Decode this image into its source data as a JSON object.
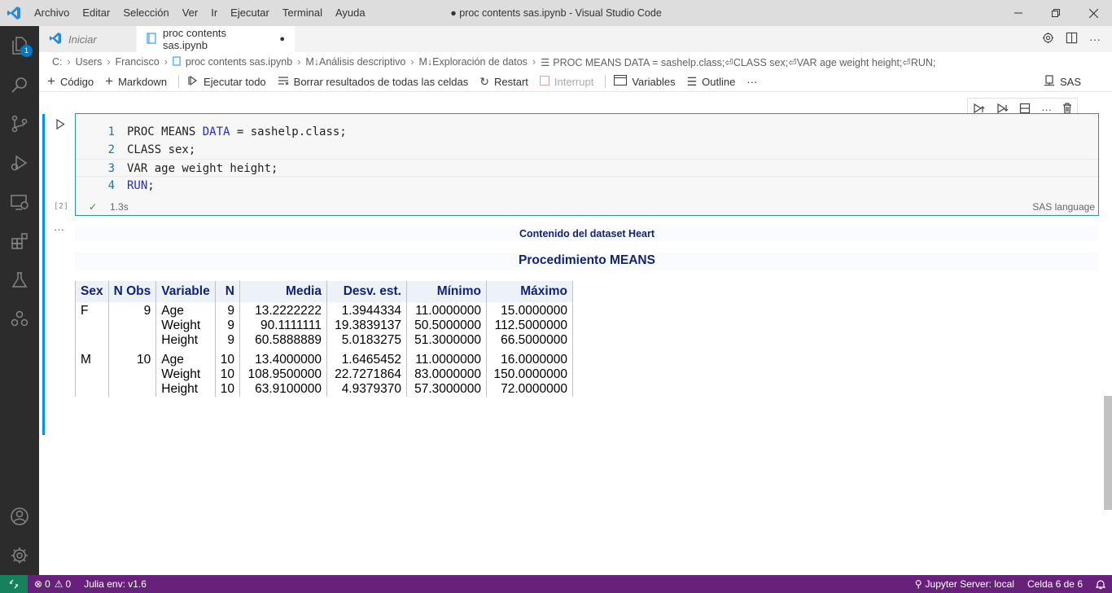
{
  "titlebar": {
    "menu": [
      "Archivo",
      "Editar",
      "Selección",
      "Ver",
      "Ir",
      "Ejecutar",
      "Terminal",
      "Ayuda"
    ],
    "window_title": "● proc contents sas.ipynb - Visual Studio Code"
  },
  "activity": {
    "explorer_badge": "1"
  },
  "tabs": {
    "inactive_label": "Iniciar",
    "active_label": "proc contents sas.ipynb",
    "active_dirty": "●"
  },
  "breadcrumb": {
    "items": [
      "C:",
      "Users",
      "Francisco",
      "proc contents sas.ipynb",
      "M↓Análisis descriptivo",
      "M↓Exploración de datos",
      "PROC MEANS DATA = sashelp.class;⏎CLASS sex;⏎VAR age weight height;⏎RUN;"
    ]
  },
  "toolbar": {
    "code": "Código",
    "markdown": "Markdown",
    "run_all": "Ejecutar todo",
    "clear_all": "Borrar resultados de todas las celdas",
    "restart": "Restart",
    "interrupt": "Interrupt",
    "variables": "Variables",
    "outline": "Outline",
    "more": "···",
    "kernel": "SAS"
  },
  "cell": {
    "exec_count": "[2]",
    "duration": "1.3s",
    "language": "SAS language",
    "lines": [
      {
        "n": "1",
        "pre": "PROC MEANS ",
        "kw": "DATA",
        "post": " = sashelp.class;"
      },
      {
        "n": "2",
        "pre": "CLASS sex;",
        "kw": "",
        "post": ""
      },
      {
        "n": "3",
        "pre": "VAR age weight height;",
        "kw": "",
        "post": ""
      },
      {
        "n": "4",
        "pre": "",
        "kw": "RUN",
        "post": ";"
      }
    ]
  },
  "output": {
    "more": "···",
    "title1": "Contenido del dataset Heart",
    "title2": "Procedimiento MEANS",
    "headers": [
      "Sex",
      "N Obs",
      "Variable",
      "N",
      "Media",
      "Desv. est.",
      "Mínimo",
      "Máximo"
    ],
    "rows": [
      {
        "sex": "F",
        "nobs": "9",
        "vars": [
          {
            "variable": "Age",
            "n": "9",
            "media": "13.2222222",
            "desv": "1.3944334",
            "min": "11.0000000",
            "max": "15.0000000"
          },
          {
            "variable": "Weight",
            "n": "9",
            "media": "90.1111111",
            "desv": "19.3839137",
            "min": "50.5000000",
            "max": "112.5000000"
          },
          {
            "variable": "Height",
            "n": "9",
            "media": "60.5888889",
            "desv": "5.0183275",
            "min": "51.3000000",
            "max": "66.5000000"
          }
        ]
      },
      {
        "sex": "M",
        "nobs": "10",
        "vars": [
          {
            "variable": "Age",
            "n": "10",
            "media": "13.4000000",
            "desv": "1.6465452",
            "min": "11.0000000",
            "max": "16.0000000"
          },
          {
            "variable": "Weight",
            "n": "10",
            "media": "108.9500000",
            "desv": "22.7271864",
            "min": "83.0000000",
            "max": "150.0000000"
          },
          {
            "variable": "Height",
            "n": "10",
            "media": "63.9100000",
            "desv": "4.9379370",
            "min": "57.3000000",
            "max": "72.0000000"
          }
        ]
      }
    ]
  },
  "statusbar": {
    "errors": "0",
    "warnings": "0",
    "julia": "Julia env: v1.6",
    "jupyter": "Jupyter Server: local",
    "cell_pos": "Celda 6 de 6"
  }
}
